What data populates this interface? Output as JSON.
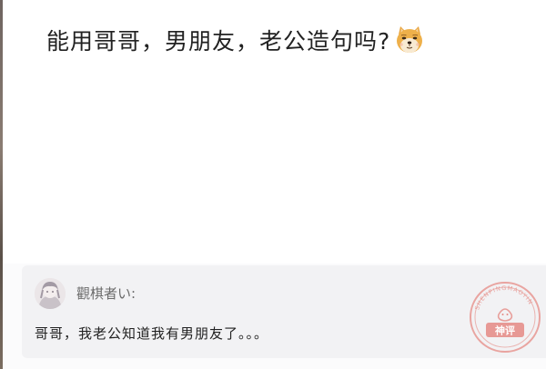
{
  "post": {
    "text": "能用哥哥，男朋友，老公造句吗?",
    "emoji": "doge-icon"
  },
  "comment": {
    "username": "觀棋者い:",
    "text": "哥哥，我老公知道我有男朋友了。。。",
    "avatar": "avatar",
    "badge": {
      "icon": "shenping-stamp-icon",
      "color": "#e0706a",
      "label": "神评",
      "ring_text": "SHENPINGMAOYIN"
    }
  }
}
